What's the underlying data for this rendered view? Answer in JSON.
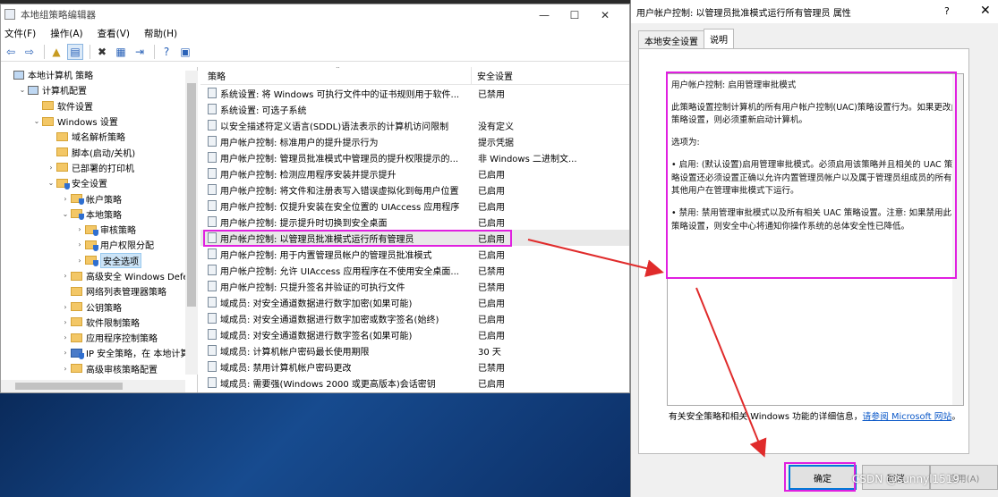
{
  "gpe": {
    "title": "本地组策略编辑器",
    "menu": [
      "文件(F)",
      "操作(A)",
      "查看(V)",
      "帮助(H)"
    ],
    "tree": [
      {
        "label": "本地计算机 策略",
        "indent": 0,
        "tw": "",
        "icon": "pc"
      },
      {
        "label": "计算机配置",
        "indent": 1,
        "tw": "⌄",
        "icon": "pc"
      },
      {
        "label": "软件设置",
        "indent": 2,
        "tw": "",
        "icon": "folder"
      },
      {
        "label": "Windows 设置",
        "indent": 2,
        "tw": "⌄",
        "icon": "folder"
      },
      {
        "label": "域名解析策略",
        "indent": 3,
        "tw": "",
        "icon": "folder"
      },
      {
        "label": "脚本(启动/关机)",
        "indent": 3,
        "tw": "",
        "icon": "folder"
      },
      {
        "label": "已部署的打印机",
        "indent": 3,
        "tw": "›",
        "icon": "folder"
      },
      {
        "label": "安全设置",
        "indent": 3,
        "tw": "⌄",
        "icon": "folder-shield"
      },
      {
        "label": "帐户策略",
        "indent": 4,
        "tw": "›",
        "icon": "folder-shield"
      },
      {
        "label": "本地策略",
        "indent": 4,
        "tw": "⌄",
        "icon": "folder-shield"
      },
      {
        "label": "审核策略",
        "indent": 5,
        "tw": "›",
        "icon": "folder-shield"
      },
      {
        "label": "用户权限分配",
        "indent": 5,
        "tw": "›",
        "icon": "folder-shield"
      },
      {
        "label": "安全选项",
        "indent": 5,
        "tw": "›",
        "icon": "folder-shield",
        "selected": true
      },
      {
        "label": "高级安全 Windows Defen",
        "indent": 4,
        "tw": "›",
        "icon": "folder"
      },
      {
        "label": "网络列表管理器策略",
        "indent": 4,
        "tw": "",
        "icon": "folder"
      },
      {
        "label": "公钥策略",
        "indent": 4,
        "tw": "›",
        "icon": "folder"
      },
      {
        "label": "软件限制策略",
        "indent": 4,
        "tw": "›",
        "icon": "folder"
      },
      {
        "label": "应用程序控制策略",
        "indent": 4,
        "tw": "›",
        "icon": "folder"
      },
      {
        "label": "IP 安全策略，在 本地计算",
        "indent": 4,
        "tw": "›",
        "icon": "shield"
      },
      {
        "label": "高级审核策略配置",
        "indent": 4,
        "tw": "›",
        "icon": "folder"
      }
    ],
    "columns": {
      "policy": "策略",
      "setting": "安全设置"
    },
    "rows": [
      {
        "policy": "系统设置: 将 Windows 可执行文件中的证书规则用于软件...",
        "setting": "已禁用"
      },
      {
        "policy": "系统设置: 可选子系统",
        "setting": ""
      },
      {
        "policy": "以安全描述符定义语言(SDDL)语法表示的计算机访问限制",
        "setting": "没有定义"
      },
      {
        "policy": "用户帐户控制: 标准用户的提升提示行为",
        "setting": "提示凭据"
      },
      {
        "policy": "用户帐户控制: 管理员批准模式中管理员的提升权限提示的...",
        "setting": "非 Windows 二进制文..."
      },
      {
        "policy": "用户帐户控制: 检测应用程序安装并提示提升",
        "setting": "已启用"
      },
      {
        "policy": "用户帐户控制: 将文件和注册表写入错误虚拟化到每用户位置",
        "setting": "已启用"
      },
      {
        "policy": "用户帐户控制: 仅提升安装在安全位置的 UIAccess 应用程序",
        "setting": "已启用"
      },
      {
        "policy": "用户帐户控制: 提示提升时切换到安全桌面",
        "setting": "已启用"
      },
      {
        "policy": "用户帐户控制: 以管理员批准模式运行所有管理员",
        "setting": "已启用",
        "highlight": true
      },
      {
        "policy": "用户帐户控制: 用于内置管理员帐户的管理员批准模式",
        "setting": "已启用"
      },
      {
        "policy": "用户帐户控制: 允许 UIAccess 应用程序在不使用安全桌面...",
        "setting": "已禁用"
      },
      {
        "policy": "用户帐户控制: 只提升签名并验证的可执行文件",
        "setting": "已禁用"
      },
      {
        "policy": "域成员: 对安全通道数据进行数字加密(如果可能)",
        "setting": "已启用"
      },
      {
        "policy": "域成员: 对安全通道数据进行数字加密或数字签名(始终)",
        "setting": "已启用"
      },
      {
        "policy": "域成员: 对安全通道数据进行数字签名(如果可能)",
        "setting": "已启用"
      },
      {
        "policy": "域成员: 计算机帐户密码最长使用期限",
        "setting": "30 天"
      },
      {
        "policy": "域成员: 禁用计算机帐户密码更改",
        "setting": "已禁用"
      },
      {
        "policy": "域成员: 需要强(Windows 2000 或更高版本)会话密钥",
        "setting": "已启用"
      }
    ]
  },
  "dialog": {
    "title": "用户帐户控制: 以管理员批准模式运行所有管理员 属性",
    "help": "?",
    "close": "✕",
    "tabs": [
      "本地安全设置",
      "说明"
    ],
    "explain_title": "用户帐户控制: 启用管理审批模式",
    "explain_p1": "此策略设置控制计算机的所有用户帐户控制(UAC)策略设置行为。如果更改此策略设置，则必须重新启动计算机。",
    "explain_p2": "选项为:",
    "explain_p3": "• 启用: (默认设置)启用管理审批模式。必须启用该策略并且相关的 UAC 策略设置还必须设置正确以允许内置管理员帐户以及属于管理员组成员的所有其他用户在管理审批模式下运行。",
    "explain_p4": "• 禁用: 禁用管理审批模式以及所有相关 UAC 策略设置。注意: 如果禁用此策略设置，则安全中心将通知你操作系统的总体安全性已降低。",
    "more_text": "有关安全策略和相关 Windows 功能的详细信息，",
    "more_link": "请参阅 Microsoft 网站",
    "more_end": "。",
    "ok": "确定",
    "cancel": "取消",
    "apply": "应用(A)"
  },
  "watermark": "CSDN @sunnyl1519"
}
